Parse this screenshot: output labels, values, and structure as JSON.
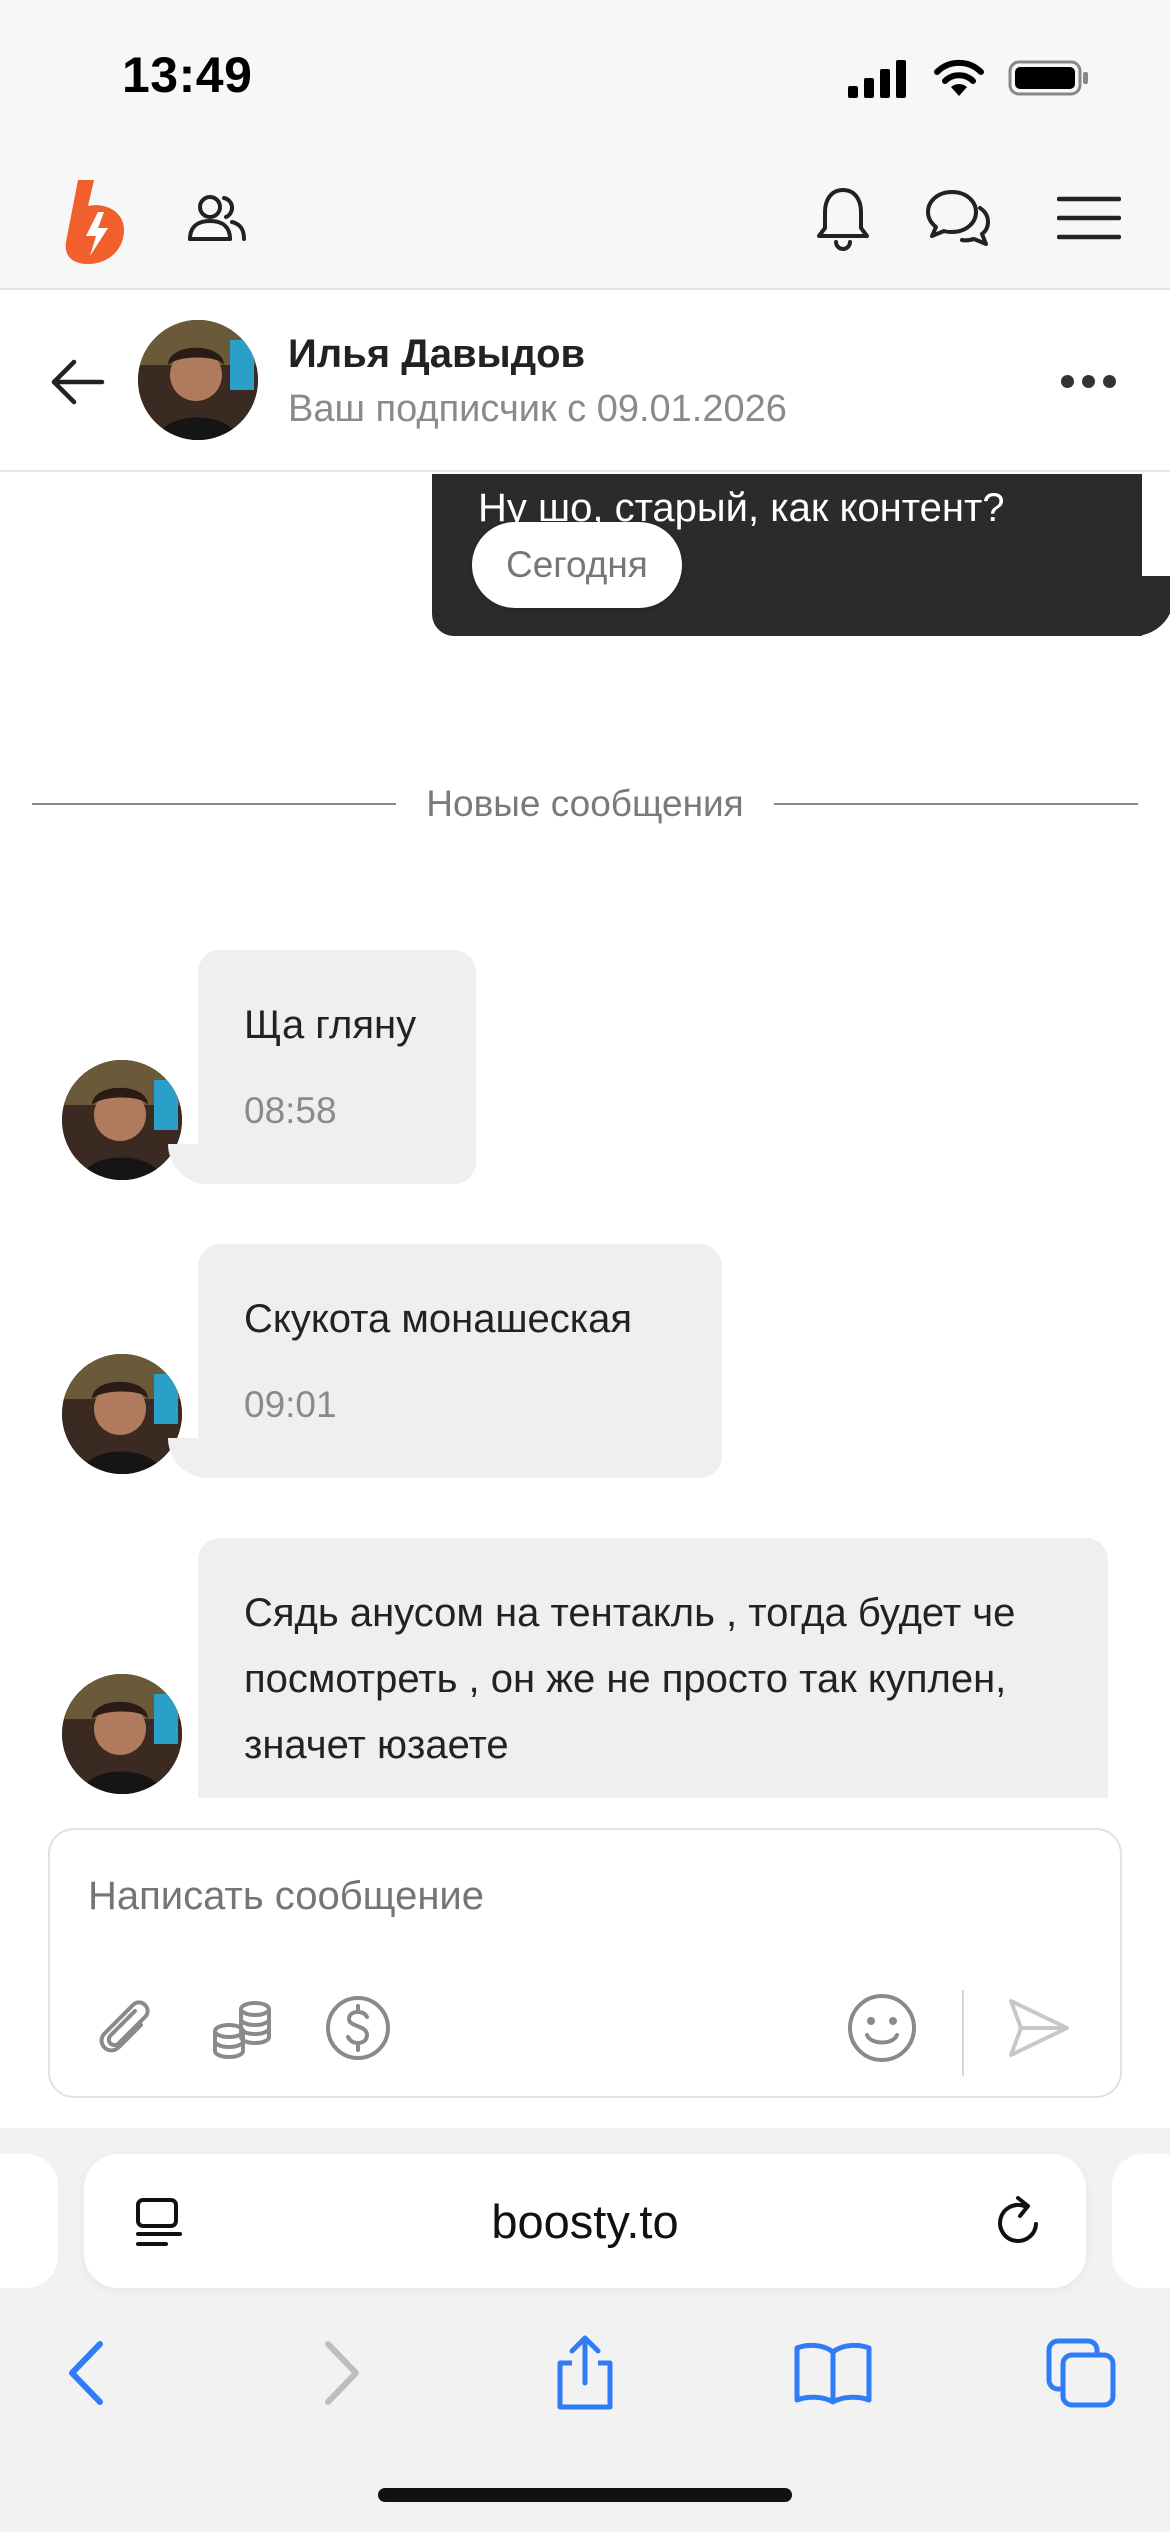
{
  "status_bar": {
    "time": "13:49"
  },
  "site_header": {
    "logo": "boosty-logo",
    "icons": [
      "people-icon",
      "bell-icon",
      "chat-bubbles-icon",
      "menu-icon"
    ]
  },
  "chat_header": {
    "name": "Илья Давыдов",
    "subtitle": "Ваш подписчик с 09.01.2026"
  },
  "messages": {
    "outgoing": {
      "text": "Ну шо, старый, как контент?"
    },
    "date_chip": "Сегодня",
    "divider_label": "Новые сообщения",
    "incoming": [
      {
        "text": "Ща гляну",
        "time": "08:58"
      },
      {
        "text": "Скукота монашеская",
        "time": "09:01"
      },
      {
        "text": "Сядь анусом на тентакль , тогда будет че посмотреть , он же не просто так куплен, значет юзаете"
      }
    ]
  },
  "composer": {
    "placeholder": "Написать сообщение",
    "tools": [
      "paperclip-icon",
      "coins-icon",
      "dollar-circle-icon",
      "emoji-icon",
      "send-icon"
    ]
  },
  "browser": {
    "url": "boosty.to",
    "toolbar": [
      "back-arrow-icon",
      "forward-arrow-icon",
      "share-icon",
      "bookmarks-icon",
      "tabs-icon"
    ]
  },
  "colors": {
    "brand": "#f15f2c",
    "outgoing_bubble": "#2b2b2b",
    "incoming_bubble": "#efefef",
    "safari_blue": "#2f7cf6"
  }
}
